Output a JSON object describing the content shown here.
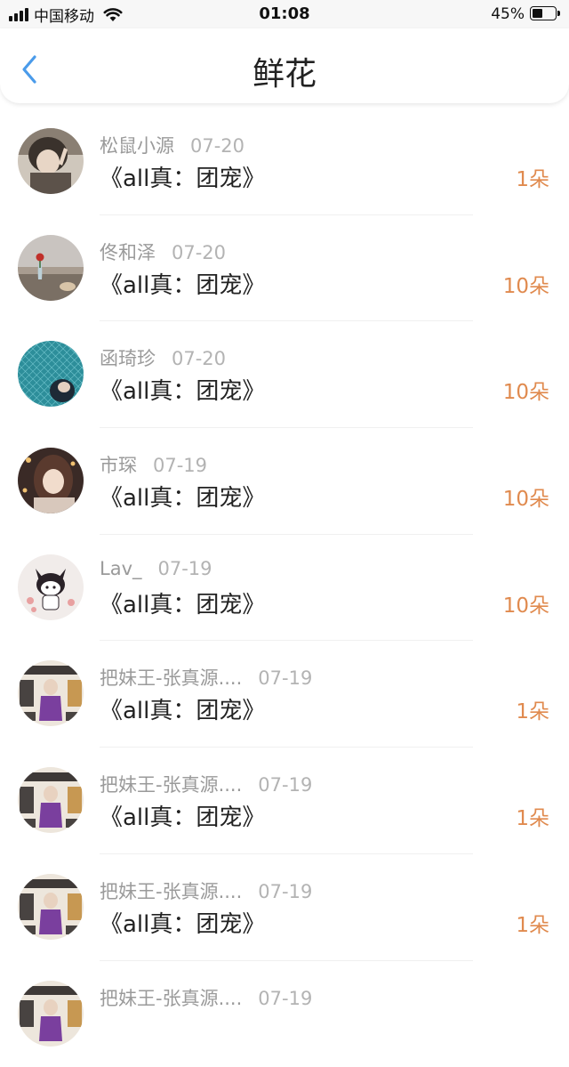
{
  "status_bar": {
    "carrier": "中国移动",
    "time": "01:08",
    "battery_percent": "45%",
    "battery_level": 0.45,
    "icons": [
      "signal-icon",
      "wifi-icon",
      "battery-icon"
    ]
  },
  "nav": {
    "title": "鲜花",
    "back_icon": "chevron-left-icon"
  },
  "colors": {
    "accent": "#e08a4e",
    "back_icon": "#4a9bea",
    "meta_text": "#9a9a9a"
  },
  "items": [
    {
      "user": "松鼠小源",
      "date": "07-20",
      "title": "《all真：团宠》",
      "count": "1朵"
    },
    {
      "user": "佟和泽",
      "date": "07-20",
      "title": "《all真：团宠》",
      "count": "10朵"
    },
    {
      "user": "函琦珍",
      "date": "07-20",
      "title": "《all真：团宠》",
      "count": "10朵"
    },
    {
      "user": "市琛",
      "date": "07-19",
      "title": "《all真：团宠》",
      "count": "10朵"
    },
    {
      "user": "Lav_",
      "date": "07-19",
      "title": "《all真：团宠》",
      "count": "10朵"
    },
    {
      "user": "把妹王-张真源....",
      "date": "07-19",
      "title": "《all真：团宠》",
      "count": "1朵"
    },
    {
      "user": "把妹王-张真源....",
      "date": "07-19",
      "title": "《all真：团宠》",
      "count": "1朵"
    },
    {
      "user": "把妹王-张真源....",
      "date": "07-19",
      "title": "《all真：团宠》",
      "count": "1朵"
    },
    {
      "user": "把妹王-张真源....",
      "date": "07-19",
      "title": "",
      "count": ""
    }
  ]
}
